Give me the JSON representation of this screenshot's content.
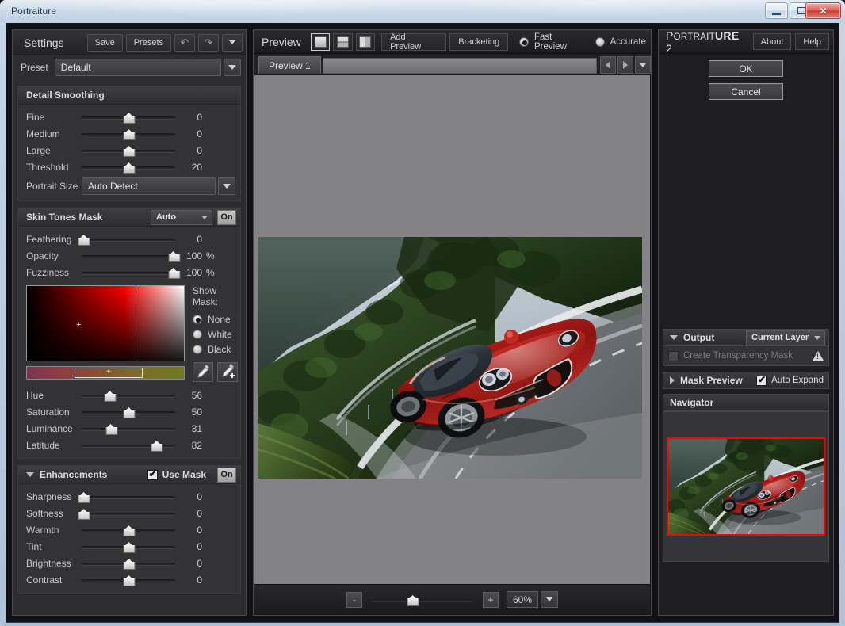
{
  "window": {
    "title": "Portraiture",
    "buttons": {
      "minimize": "minimize-button",
      "maximize": "maximize-button",
      "close": "✕"
    }
  },
  "settings": {
    "title": "Settings",
    "toolbar": {
      "save": "Save",
      "presets": "Presets",
      "undo": "↶",
      "redo": "↷",
      "more": "▾"
    },
    "preset": {
      "label": "Preset",
      "value": "Default"
    },
    "detail_smoothing": {
      "title": "Detail Smoothing",
      "sliders": [
        {
          "name": "Fine",
          "value": "0",
          "pos": 50
        },
        {
          "name": "Medium",
          "value": "0",
          "pos": 50
        },
        {
          "name": "Large",
          "value": "0",
          "pos": 50
        },
        {
          "name": "Threshold",
          "value": "20",
          "pos": 50
        }
      ],
      "portrait_size": {
        "label": "Portrait Size",
        "value": "Auto Detect"
      }
    },
    "skin_tones_mask": {
      "title": "Skin Tones Mask",
      "mode": "Auto",
      "toggle": "On",
      "sliders": [
        {
          "name": "Feathering",
          "value": "0",
          "unit": "",
          "pos": 2
        },
        {
          "name": "Opacity",
          "value": "100",
          "unit": "%",
          "pos": 98
        },
        {
          "name": "Fuzziness",
          "value": "100",
          "unit": "%",
          "pos": 98
        }
      ],
      "show_mask": {
        "title": "Show Mask:",
        "options": [
          {
            "label": "None",
            "selected": true
          },
          {
            "label": "White",
            "selected": false
          },
          {
            "label": "Black",
            "selected": false
          }
        ]
      },
      "droppers": [
        "eyedropper-icon",
        "eyedropper-add-icon"
      ],
      "hsl": [
        {
          "name": "Hue",
          "value": "56",
          "pos": 30
        },
        {
          "name": "Saturation",
          "value": "50",
          "pos": 50
        },
        {
          "name": "Luminance",
          "value": "31",
          "pos": 31
        },
        {
          "name": "Latitude",
          "value": "82",
          "pos": 80
        }
      ]
    },
    "enhancements": {
      "title": "Enhancements",
      "use_mask_label": "Use Mask",
      "use_mask_checked": true,
      "toggle": "On",
      "sliders": [
        {
          "name": "Sharpness",
          "value": "0",
          "pos": 2
        },
        {
          "name": "Softness",
          "value": "0",
          "pos": 2
        },
        {
          "name": "Warmth",
          "value": "0",
          "pos": 50
        },
        {
          "name": "Tint",
          "value": "0",
          "pos": 50
        },
        {
          "name": "Brightness",
          "value": "0",
          "pos": 50
        },
        {
          "name": "Contrast",
          "value": "0",
          "pos": 50
        }
      ]
    }
  },
  "preview": {
    "title": "Preview",
    "modes": [
      {
        "name": "single-pane",
        "selected": true
      },
      {
        "name": "horizontal-split",
        "selected": false
      },
      {
        "name": "vertical-split",
        "selected": false
      }
    ],
    "add_preview": "Add Preview",
    "bracketing": "Bracketing",
    "quality": [
      {
        "label": "Fast Preview",
        "selected": true
      },
      {
        "label": "Accurate",
        "selected": false
      }
    ],
    "tabs": [
      {
        "label": "Preview 1",
        "active": true
      }
    ],
    "zoom": {
      "minus": "-",
      "plus": "+",
      "value": "60%",
      "pos": 40
    }
  },
  "right": {
    "brand": {
      "p": "P",
      "ortrait": "ORTRAIT",
      "ure": "URE",
      "num": " 2"
    },
    "about": "About",
    "help": "Help",
    "ok": "OK",
    "cancel": "Cancel",
    "output": {
      "title": "Output",
      "target": "Current Layer",
      "transparency_mask": "Create Transparency Mask",
      "transparency_checked": false
    },
    "mask_preview": {
      "title": "Mask Preview",
      "auto_expand": "Auto Expand",
      "auto_expand_checked": true
    },
    "navigator": {
      "title": "Navigator"
    }
  },
  "colors": {
    "accent_red": "#ff0000",
    "panel_bg": "#333335",
    "header_bg": "#2c2c2e",
    "text": "#c9c9cb",
    "canvas_bg": "#838385"
  }
}
